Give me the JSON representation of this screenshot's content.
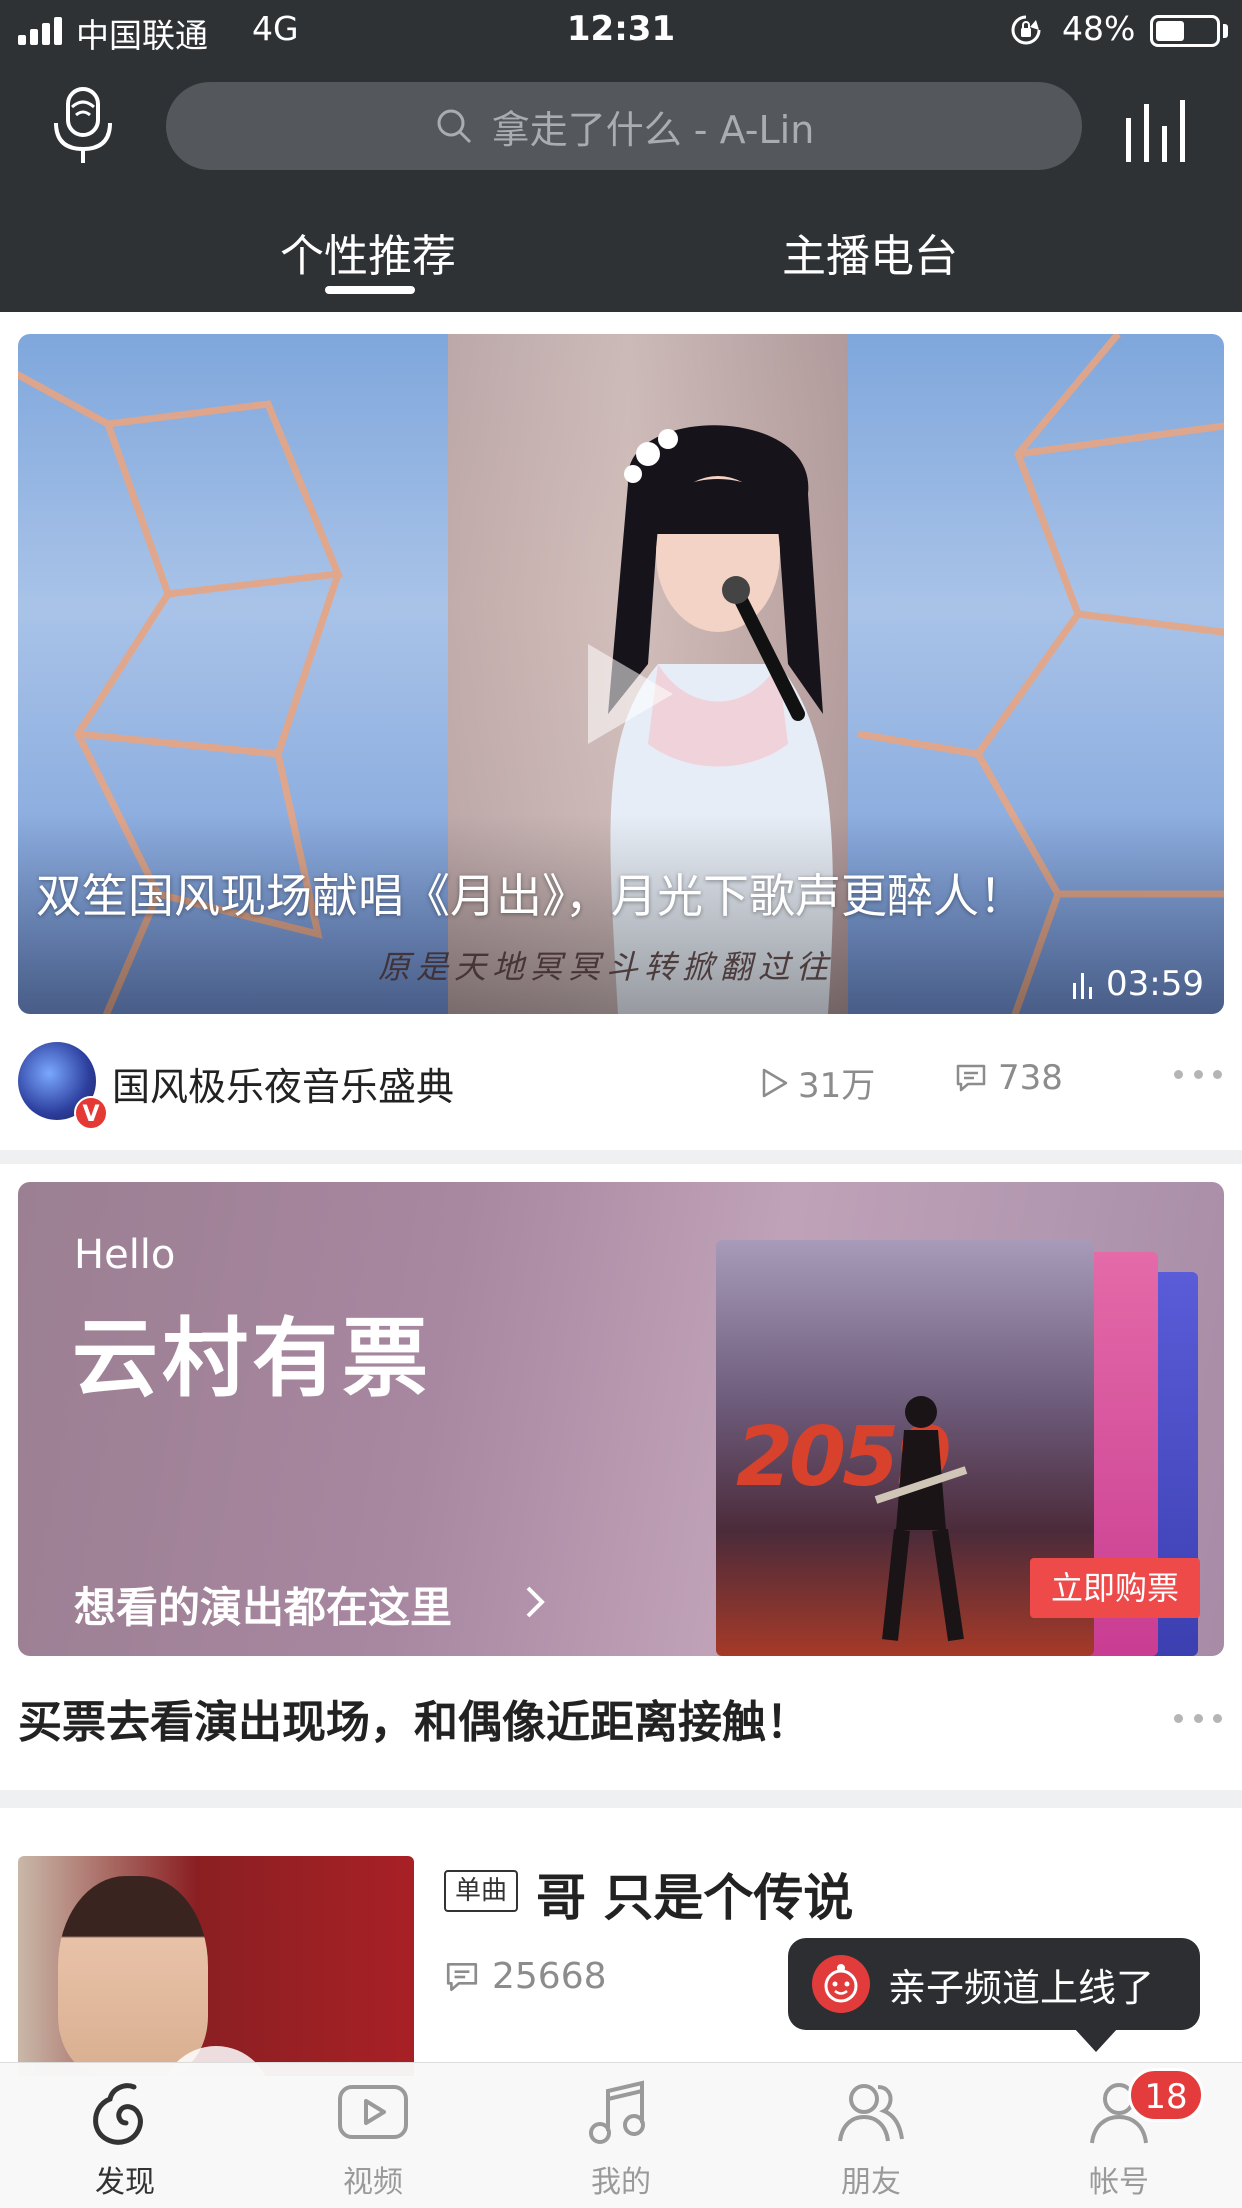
{
  "status_bar": {
    "carrier": "中国联通",
    "network": "4G",
    "time": "12:31",
    "battery_percent": "48%",
    "battery_level": 0.48
  },
  "header": {
    "search_placeholder": "拿走了什么 - A-Lin",
    "tabs": [
      {
        "label": "个性推荐",
        "active": true
      },
      {
        "label": "主播电台",
        "active": false
      }
    ]
  },
  "video_card": {
    "title": "双笙国风现场献唱《月出》，月光下歌声更醉人！",
    "subtitle": "原是天地冥冥斗转掀翻过往",
    "duration": "03:59",
    "channel": "国风极乐夜音乐盛典",
    "verified_badge": "V",
    "plays": "31万",
    "comments": "738"
  },
  "ticket_card": {
    "hello": "Hello",
    "brand": "云村有票",
    "cta": "想看的演出都在这里",
    "buy_button": "立即购票",
    "poster_text": "2059",
    "caption": "买票去看演出现场，和偶像近距离接触！"
  },
  "single_card": {
    "tag": "单曲",
    "song_title": "哥 只是个传说",
    "comments": "25668"
  },
  "toast": {
    "text": "亲子频道上线了"
  },
  "tabbar": {
    "items": [
      {
        "label": "发现",
        "icon": "netease-music-icon",
        "active": true
      },
      {
        "label": "视频",
        "icon": "video-play-icon",
        "active": false
      },
      {
        "label": "我的",
        "icon": "music-note-icon",
        "active": false
      },
      {
        "label": "朋友",
        "icon": "friends-icon",
        "active": false
      },
      {
        "label": "帐号",
        "icon": "account-icon",
        "active": false
      }
    ],
    "account_badge": "18"
  },
  "colors": {
    "header_bg": "#2f3235",
    "accent_red": "#e43c3c",
    "page_bg": "#eef0f2"
  }
}
